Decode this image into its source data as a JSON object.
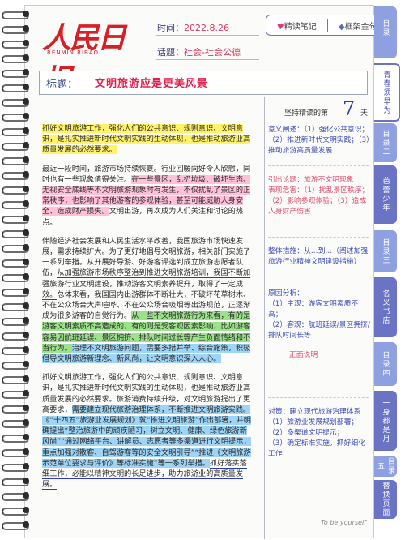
{
  "header": {
    "logo_cn": "人民日报",
    "logo_en": "RENMIN RIBAO",
    "time_label": "时间：",
    "time_value": "2022.8.26",
    "topic_label": "话题：",
    "topic_value": "社会-社会公德",
    "btn_notes": "精读笔记",
    "btn_frame": "框架金句"
  },
  "title": {
    "label": "标题：",
    "text": "文明旅游应是更美风景"
  },
  "paragraphs": [
    [
      {
        "t": "抓好文明旅游工作，强化人们的公共意识、规则意识、文明意识，是扎实推进新时代文明实践的生动体现，也是推动旅游业高质量发展的必然要求。",
        "h": "yellow"
      }
    ],
    [
      {
        "t": "最近一段时间，旅游市场持续恢复。行业回暖向好令人欣慰，同时也有一些现象值得关注。",
        "h": ""
      },
      {
        "t": "在一些景区，乱扔垃圾、破坏生态、无视安全底线等不文明旅游现象时有发生，不仅扰乱了景区的正常秩序，也影响了其他游客的参观体验，甚至可能威胁人身安全、造成财产损失。",
        "h": "pink"
      },
      {
        "t": "文明出游，再次成为人们关注和讨论的热点。",
        "h": ""
      }
    ],
    [
      {
        "t": "伴随经济社会发展和人民生活水平改善，我国旅游市场快速发展，需求持续扩大。为了更好地倡导文明旅游，相关部门实施了一系列举措。从开展好导游、好游客评选到成立旅游志愿者队伍，",
        "h": ""
      },
      {
        "t": "从加强旅游市场秩序整治到推进文明旅游培训，我国不断加强旅游行业文明建设，推动游客文明素养提升，取得了一定成效。",
        "h": "ublue"
      },
      {
        "t": "总体来看，我国国内出游群体不断壮大，不破坏花草树木、不在公众场合大声喧哗、不在公众场合吸烟等出游规范，正逐渐成为很多游客的自觉行为。",
        "h": ""
      },
      {
        "t": "从一些不文明旅游行为来看，有的是游客文明素质不高造成的，有的则是受客观因素影响，比如游客容易因航班延误、景区拥挤、排队时间过长等产生负面情绪和不当行为。",
        "h": "green"
      },
      {
        "t": "治理不文明旅游问题，需要多措并举、综合施策，积极倡导文明旅游新理念、新风尚，让文明意识深入人心。",
        "h": "blue"
      }
    ],
    [
      {
        "t": "抓好文明旅游工作，强化人们的公共意识、规则意识、文明意识，是扎实推进新时代文明实践的生动体现，也是推动旅游业高质量发展的必然要求。旅游消费持续升级，对文明旅游提出了更高要求，",
        "h": ""
      },
      {
        "t": "需要建立现代旅游治理体系，不断推进文明旅游实践。《“十四五”旅游业发展规划》就“推进文明旅游”作出部署，并明确提出“整治旅游中的顽疾陋习，树立文明、健康、绿色旅游新风尚”“通过网络平台、讲解员、志愿者等多渠道进行文明提示，重点加强对散客、自驾游客等的安全文明引导”“推进《文明旅游示范单位要求与评价》等标准实施”等一系列举措。",
        "h": "blue"
      },
      {
        "t": "抓好落实落细工作，必能以精神文明的长足进步，助力旅游业的高质量发展。",
        "h": "ublue"
      }
    ]
  ],
  "right": {
    "head": "坚持精读的第",
    "day": "7",
    "tian": "天",
    "block1": "意义阐述：（1）强化公共意识；（2）推进新时代文明实践；（3）推动旅游高质量发展",
    "block2": "引出论题：旅游不文明现象\n表现危害：（1）扰乱景区秩序；（2）影响参观体验；（3）造成人身财产伤害",
    "block3": "整体措施：从…到…（阐述加强旅游行业精神文明建设措施）",
    "block4": "原因分析：\n（1）主观：游客文明素质不高；\n（2）客观：航班延误/景区拥挤/排队时间长等",
    "block5": "正面说明",
    "block6": "对策：建立现代旅游治理体系\n（1）旅游业发展规划部署；\n（2）多渠道文明提示；\n（3）确定标准实施，抓好细化工作",
    "footer": "To be yourself"
  },
  "tabs": [
    "目录一",
    "青春须早为",
    "目录二",
    "芭蕾少年",
    "目录三",
    "名义书店",
    "目录四",
    "一身都是月",
    "目录五",
    "替换页面"
  ],
  "colors": {
    "accent": "#6b74c4",
    "title_red": "#e21e4a",
    "highlight_yellow": "#fff36a",
    "highlight_pink": "#ffc0d8",
    "highlight_green": "#9be38a",
    "highlight_blue": "#9ed4f6"
  }
}
